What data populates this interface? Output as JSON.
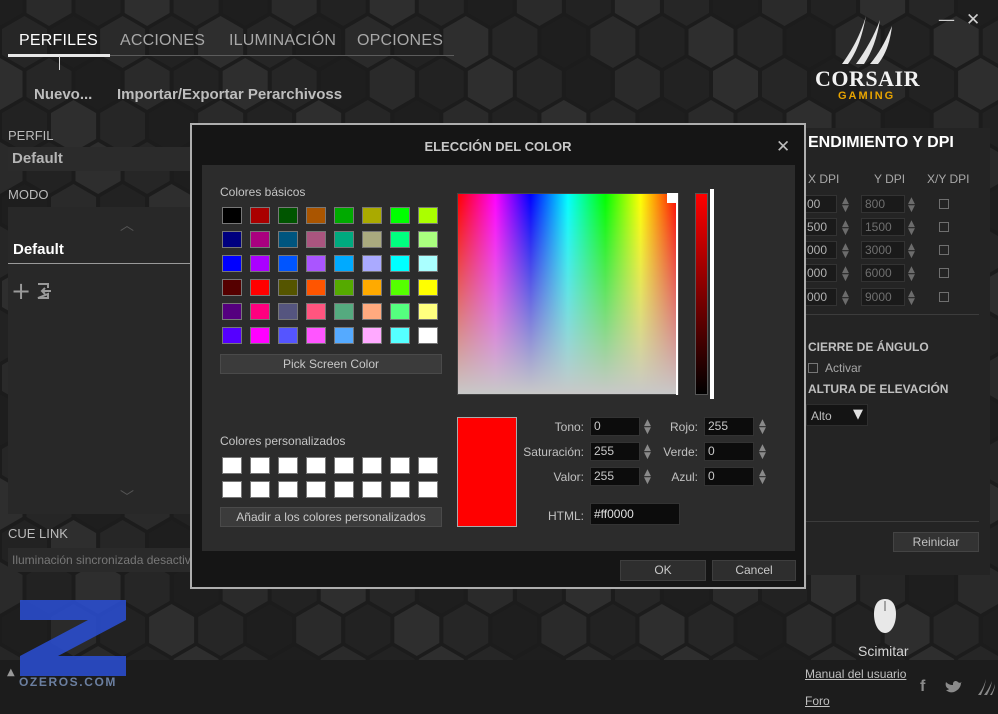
{
  "window": {
    "minimize_glyph": "—",
    "close_glyph": "✕"
  },
  "nav": {
    "tabs": [
      {
        "label": "PERFILES",
        "active": true
      },
      {
        "label": "ACCIONES",
        "active": false
      },
      {
        "label": "ILUMINACIÓN",
        "active": false
      },
      {
        "label": "OPCIONES",
        "active": false
      }
    ],
    "sub_links": [
      "Nuevo...",
      "Importar/Exportar Perarchivoss"
    ]
  },
  "left_panel": {
    "profile_label": "PERFIL",
    "profile_value": "Default",
    "mode_label": "MODO",
    "mode_item": "Default",
    "add_glyph": "+",
    "cue_link_label": "CUE LINK",
    "cue_link_value": "Iluminación sincronizada desactivada"
  },
  "logo": {
    "brand": "CORSAIR",
    "sub": "GAMING",
    "brand_color": "#e8a400"
  },
  "right_panel": {
    "title": "ENDIMIENTO Y DPI",
    "headers": [
      "X DPI",
      "Y DPI",
      "X/Y DPI"
    ],
    "rows": [
      {
        "x": "00",
        "y": "800"
      },
      {
        "x": "500",
        "y": "1500"
      },
      {
        "x": "000",
        "y": "3000"
      },
      {
        "x": "000",
        "y": "6000"
      },
      {
        "x": "000",
        "y": "9000"
      }
    ],
    "angle_title": "CIERRE DE ÁNGULO",
    "angle_checkbox_label": "Activar",
    "height_title": "ALTURA DE ELEVACIÓN",
    "height_value": "Alto",
    "reset_label": "Reiniciar"
  },
  "device": {
    "name": "Scimitar"
  },
  "footer": {
    "manual_link": "Manual del usuario",
    "forum_link": "Foro",
    "social_icons": [
      "facebook-icon",
      "twitter-icon",
      "corsair-icon"
    ],
    "expand_glyph": "▲"
  },
  "watermark": {
    "text": "OZEROS.COM",
    "color": "#2a4fd6"
  },
  "dialog": {
    "title": "ELECCIÓN DEL COLOR",
    "close_glyph": "✕",
    "basic_colors_label": "Colores básicos",
    "basic_colors": [
      [
        "#000000",
        "#aa0000",
        "#005500",
        "#aa5500",
        "#00aa00",
        "#aaaa00",
        "#00ff00",
        "#aaff00"
      ],
      [
        "#00007f",
        "#aa007f",
        "#00557f",
        "#aa557f",
        "#00aa7f",
        "#aaaa7f",
        "#00ff7f",
        "#aaff7f"
      ],
      [
        "#0000ff",
        "#aa00ff",
        "#0055ff",
        "#aa55ff",
        "#00aaff",
        "#aaaaff",
        "#00ffff",
        "#aaffff"
      ],
      [
        "#550000",
        "#ff0000",
        "#555500",
        "#ff5500",
        "#55aa00",
        "#ffaa00",
        "#55ff00",
        "#ffff00"
      ],
      [
        "#55007f",
        "#ff007f",
        "#55557f",
        "#ff557f",
        "#55aa7f",
        "#ffaa7f",
        "#55ff7f",
        "#ffff7f"
      ],
      [
        "#5500ff",
        "#ff00ff",
        "#5555ff",
        "#ff55ff",
        "#55aaff",
        "#ffaaff",
        "#55ffff",
        "#ffffff"
      ]
    ],
    "pick_screen_label": "Pick Screen Color",
    "custom_colors_label": "Colores personalizados",
    "custom_colors": [
      [
        "#ffffff",
        "#ffffff",
        "#ffffff",
        "#ffffff",
        "#ffffff",
        "#ffffff",
        "#ffffff",
        "#ffffff"
      ],
      [
        "#ffffff",
        "#ffffff",
        "#ffffff",
        "#ffffff",
        "#ffffff",
        "#ffffff",
        "#ffffff",
        "#ffffff"
      ]
    ],
    "add_custom_label": "Añadir a los colores personalizados",
    "selected_color": "#ff0000",
    "fields": {
      "tono": {
        "label": "Tono:",
        "value": "0"
      },
      "saturacion": {
        "label": "Saturación:",
        "value": "255"
      },
      "valor": {
        "label": "Valor:",
        "value": "255"
      },
      "rojo": {
        "label": "Rojo:",
        "value": "255"
      },
      "verde": {
        "label": "Verde:",
        "value": "0"
      },
      "azul": {
        "label": "Azul:",
        "value": "0"
      },
      "html": {
        "label": "HTML:",
        "value": "#ff0000"
      }
    },
    "ok_label": "OK",
    "cancel_label": "Cancel"
  }
}
